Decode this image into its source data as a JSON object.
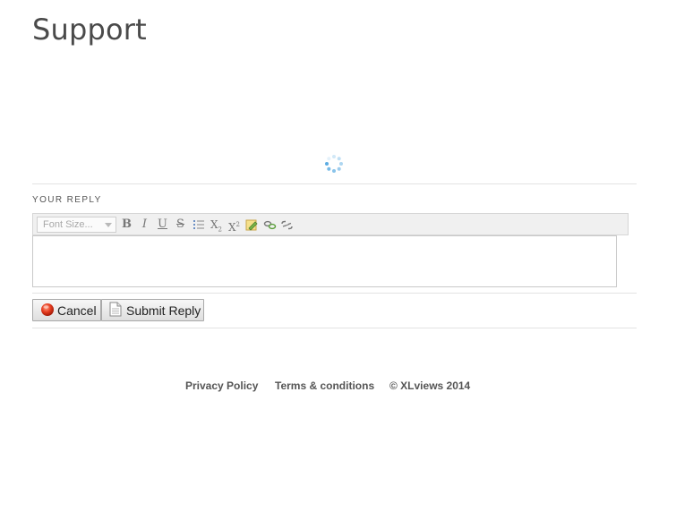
{
  "page": {
    "title": "Support"
  },
  "reply": {
    "label": "YOUR REPLY",
    "font_size_placeholder": "Font Size...",
    "editor_text": ""
  },
  "toolbar": {
    "bold": "B",
    "italic": "I",
    "underline": "U",
    "strike": "S",
    "subscript": "X",
    "subscript_mark": "2",
    "superscript": "X",
    "superscript_mark": "2"
  },
  "actions": {
    "cancel_label": "Cancel",
    "submit_label": "Submit Reply"
  },
  "footer": {
    "privacy": "Privacy Policy",
    "terms": "Terms & conditions",
    "copyright": "© XLviews 2014"
  },
  "colors": {
    "cancel_icon": "#e53b1e",
    "spinner": "#4aa3df"
  },
  "icons": {
    "loading": "loading-spinner-icon",
    "list": "bulleted-list-icon",
    "color": "text-color-icon",
    "link": "link-icon",
    "unlink": "unlink-icon",
    "cancel": "cancel-icon",
    "submit": "document-icon"
  }
}
